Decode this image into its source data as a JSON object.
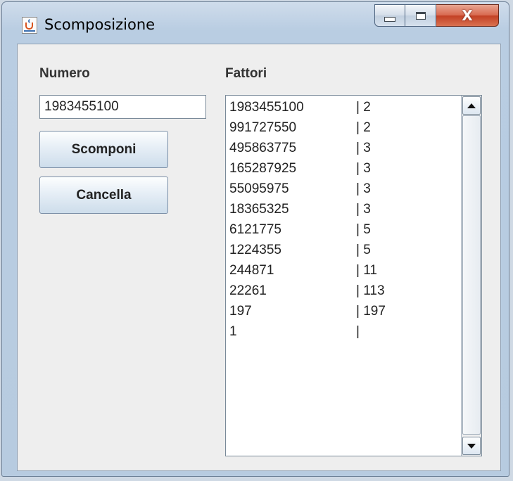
{
  "window": {
    "title": "Scomposizione",
    "app_icon": "java-coffee-cup-icon",
    "controls": {
      "minimize": "minimize-icon",
      "maximize": "maximize-icon",
      "close_glyph": "X"
    }
  },
  "numero": {
    "label": "Numero",
    "value": "1983455100"
  },
  "buttons": {
    "scomponi": "Scomponi",
    "cancella": "Cancella"
  },
  "fattori": {
    "label": "Fattori",
    "rows": [
      {
        "n": "1983455100",
        "f": "| 2"
      },
      {
        "n": "991727550",
        "f": "| 2"
      },
      {
        "n": "495863775",
        "f": "| 3"
      },
      {
        "n": "165287925",
        "f": "| 3"
      },
      {
        "n": "55095975",
        "f": "| 3"
      },
      {
        "n": "18365325",
        "f": "| 3"
      },
      {
        "n": "6121775",
        "f": "| 5"
      },
      {
        "n": "1224355",
        "f": "| 5"
      },
      {
        "n": "244871",
        "f": "| 11"
      },
      {
        "n": "22261",
        "f": "| 113"
      },
      {
        "n": "197",
        "f": "| 197"
      },
      {
        "n": "1",
        "f": "|"
      }
    ]
  }
}
